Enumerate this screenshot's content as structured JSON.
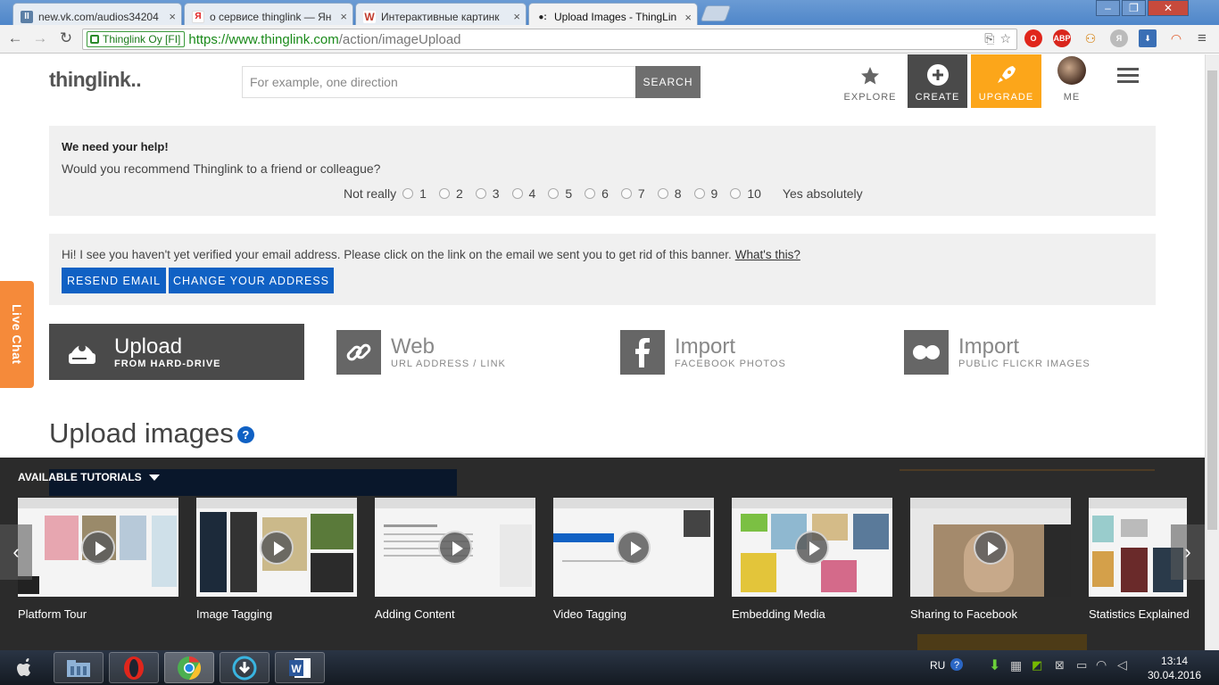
{
  "browser": {
    "tabs": [
      {
        "title": "new.vk.com/audios34204",
        "favicon": "vk-pause-icon"
      },
      {
        "title": "о сервисе thinglink — Ян",
        "favicon": "yandex-icon"
      },
      {
        "title": "Интерактивные картинк",
        "favicon": "wikipedia-icon"
      },
      {
        "title": "Upload Images - ThingLin",
        "favicon": "thinglink-icon"
      }
    ],
    "close_glyph": "×",
    "ev_label": "Thinglink Oy [FI]",
    "url_scheme_host": "https://www.thinglink.com",
    "url_path": "/action/imageUpload",
    "extensions": [
      "ABP"
    ]
  },
  "header": {
    "logo": "thinglink..",
    "search_placeholder": "For example, one direction",
    "search_button": "SEARCH",
    "nav": {
      "explore": "EXPLORE",
      "create": "CREATE",
      "upgrade": "UPGRADE",
      "me": "ME"
    }
  },
  "survey": {
    "title": "We need your help!",
    "question": "Would you recommend Thinglink to a friend or colleague?",
    "low_label": "Not really",
    "high_label": "Yes absolutely",
    "options": [
      "1",
      "2",
      "3",
      "4",
      "5",
      "6",
      "7",
      "8",
      "9",
      "10"
    ]
  },
  "verify": {
    "message": "Hi! I see you haven't yet verified your email address. Please click on the link on the email we sent you to get rid of this banner.",
    "link": "What's this?",
    "resend": "RESEND EMAIL",
    "change": "CHANGE YOUR ADDRESS"
  },
  "live_chat": "Live Chat",
  "sources": [
    {
      "title": "Upload",
      "subtitle": "FROM HARD-DRIVE",
      "active": true
    },
    {
      "title": "Web",
      "subtitle": "URL ADDRESS / LINK",
      "active": false
    },
    {
      "title": "Import",
      "subtitle": "FACEBOOK PHOTOS",
      "active": false
    },
    {
      "title": "Import",
      "subtitle": "PUBLIC FLICKR IMAGES",
      "active": false
    }
  ],
  "upload_heading": "Upload images",
  "help_glyph": "?",
  "tutorials": {
    "title": "AVAILABLE TUTORIALS",
    "items": [
      "Platform Tour",
      "Image Tagging",
      "Adding Content",
      "Video Tagging",
      "Embedding Media",
      "Sharing to Facebook",
      "Statistics Explained"
    ]
  },
  "taskbar": {
    "lang": "RU",
    "time": "13:14",
    "date": "30.04.2016"
  },
  "colors": {
    "accent_blue": "#1061c4",
    "upgrade_orange": "#fca61a",
    "live_chat_orange": "#f58a3a",
    "dark_panel": "#2b2b2b"
  }
}
